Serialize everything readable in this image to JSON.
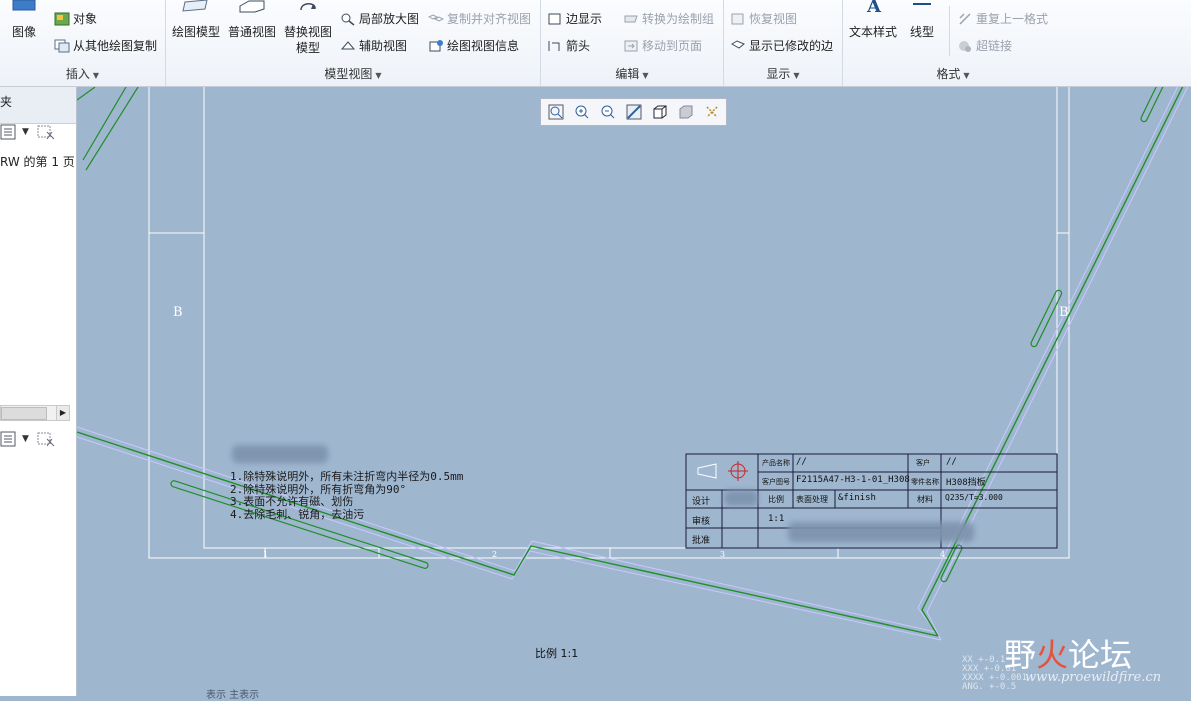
{
  "ribbon": {
    "insert": {
      "image_label": "图像",
      "object_label": "对象",
      "copy_from_label": "从其他绘图复制",
      "group_label": "插入"
    },
    "model_views": {
      "drawing_model_label": "绘图模型",
      "general_view_label": "普通视图",
      "alt_view_label_1": "替换视图",
      "alt_view_label_2": "模型",
      "detail_view_label": "局部放大图",
      "copy_align_label": "复制并对齐视图",
      "aux_view_label": "辅助视图",
      "view_info_label": "绘图视图信息",
      "group_label": "模型视图"
    },
    "edit": {
      "edge_display_label": "边显示",
      "convert_label": "转换为绘制组",
      "arrow_label": "箭头",
      "move_page_label": "移动到页面",
      "group_label": "编辑"
    },
    "display": {
      "restore_view_label": "恢复视图",
      "show_modified_label": "显示已修改的边",
      "group_label": "显示"
    },
    "format": {
      "text_style_label": "文本样式",
      "line_style_label": "线型",
      "repeat_format_label": "重复上一格式",
      "hyperlink_label": "超链接",
      "group_label": "格式"
    }
  },
  "left_panel": {
    "header_text": "夹",
    "tree_item": "RW 的第 1 页"
  },
  "drawing": {
    "zone_left": "B",
    "zone_right": "B",
    "zone_numbers": [
      "1",
      "2",
      "3",
      "4"
    ],
    "notes": [
      "1.除特殊说明外，所有未注折弯内半径为0.5mm",
      "2.除特殊说明外，所有折弯角为90°",
      "3.表面不允许有磁、划伤",
      "4.去除毛刺、锐角，去油污"
    ],
    "title_block": {
      "product_name_label": "产品名称",
      "product_name_value": "//",
      "customer_label": "客户",
      "customer_value": "//",
      "customer_drawing_label": "客户图号",
      "customer_drawing_value": "F2115A47-H3-1-01_H308",
      "part_name_label": "零件名称",
      "part_name_value": "H308挡板",
      "design_label": "设计",
      "scale_label": "比例",
      "surface_label": "表面处理",
      "surface_value": "&finish",
      "material_label": "材料",
      "material_value": "Q235/T=3.000",
      "review_label": "审核",
      "scale_value": "1:1",
      "approve_label": "批准"
    },
    "scale_text": "比例 1:1",
    "tolerances": [
      "XX  +-0.1",
      "XXX  +-0.01",
      "XXXX +-0.001",
      "ANG.  +-0.5"
    ],
    "status_text": "表示 主表示"
  },
  "watermark": {
    "text_a": "野",
    "text_b": "火",
    "text_c": "论坛",
    "url": "www.proewildfire.cn"
  },
  "colors": {
    "ribbon_bg": "#f3f6fa",
    "canvas_bg": "#9fb6cf",
    "geometry_green": "#1f8f2a",
    "frame_white": "#ffffff",
    "title_block_line": "#1a1a3a"
  }
}
